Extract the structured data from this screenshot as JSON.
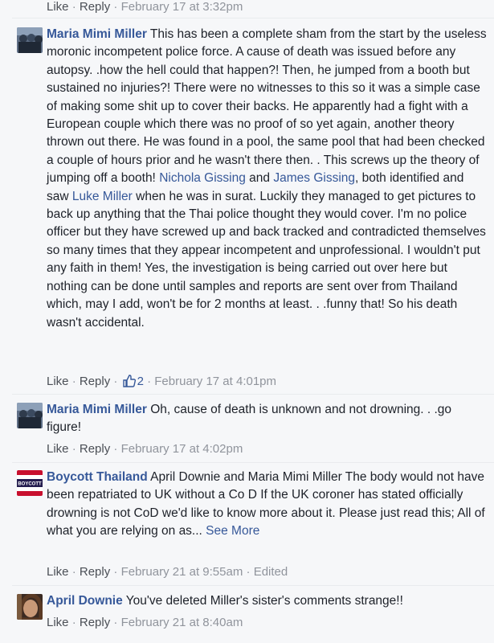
{
  "top_actions": {
    "like": "Like",
    "reply": "Reply",
    "time": "February 17 at 3:32pm"
  },
  "comments": [
    {
      "author": "Maria Mimi Miller",
      "text_1": " This has been a complete sham from the start by the useless moronic incompetent police force. A cause of death was issued before any autopsy. .how the hell could that happen?! Then, he jumped from a booth but sustained no injuries?! There were no witnesses to this so it was a simple case of making some shit up to cover their backs. He apparently had a fight with a European couple which there was no proof of so yet again, another theory thrown out there. He was found in a pool, the same pool that had been checked a couple of hours prior and he wasn't there then. . This screws up the theory of jumping off a booth! ",
      "mention_1": "Nichola Gissing",
      "text_2": " and ",
      "mention_2": "James Gissing",
      "text_3": ", both identified and saw ",
      "mention_3": "Luke Miller",
      "text_4": " when he was in surat. Luckily they managed to get pictures to back up anything that the Thai police thought they would cover. I'm no police officer but they have screwed up and back tracked and contradicted themselves so many times that they appear incompetent and unprofessional. I wouldn't put any faith in them! Yes, the investigation is being carried out over here but nothing can be done until samples and reports are sent over from Thailand which, may I add, won't be for 2 months at least. . .funny that! So his death wasn't accidental.",
      "like": "Like",
      "reply": "Reply",
      "likes": "2",
      "time": "February 17 at 4:01pm"
    },
    {
      "author": "Maria Mimi Miller",
      "text": " Oh, cause of death is unknown and not drowning. . .go figure!",
      "like": "Like",
      "reply": "Reply",
      "time": "February 17 at 4:02pm"
    },
    {
      "author": "Boycott Thailand",
      "avatar_text": "BOYCOTT",
      "text": " April Downie and Maria Mimi Miller The body would not have been repatriated to UK without a Co D If the UK coroner has stated officially drowning is not CoD we'd like to know more about it. Please just read this; All of what you are relying on as...",
      "see_more": "See More",
      "like": "Like",
      "reply": "Reply",
      "time": "February 21 at 9:55am",
      "edited": "Edited"
    },
    {
      "author": "April Downie",
      "text": " You've deleted Miller's sister's comments strange!!",
      "like": "Like",
      "reply": "Reply",
      "time": "February 21 at 8:40am"
    }
  ],
  "colors": {
    "link": "#365899",
    "meta": "#90949c",
    "text": "#1d2129",
    "background": "#f6f7f9"
  }
}
